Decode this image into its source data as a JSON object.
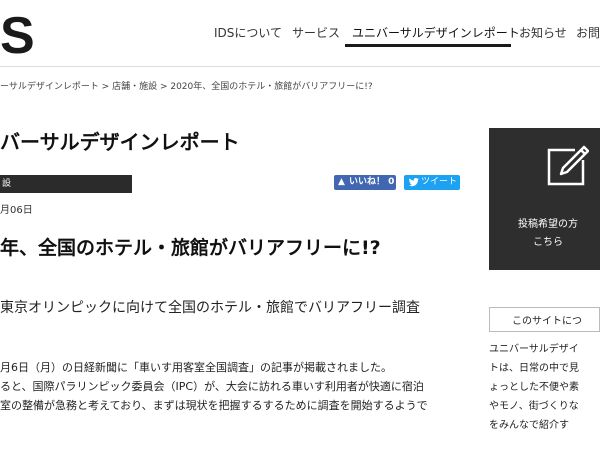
{
  "header": {
    "logo_text": "S",
    "nav": [
      {
        "label": "IDSについて"
      },
      {
        "label": "サービス"
      },
      {
        "label": "ユニバーサルデザインレポート",
        "active": true
      },
      {
        "label": "お知らせ"
      },
      {
        "label": "お問"
      }
    ]
  },
  "breadcrumb": "ーサルデザインレポート > 店舗・施設 > 2020年、全国のホテル・旅館がバリアフリーに!?",
  "section_title": "バーサルデザインレポート",
  "category_label": "設",
  "social": {
    "like_label": "いいね！ 0",
    "tweet_label": "ツイート"
  },
  "article": {
    "date": "月06日",
    "title": "年、全国のホテル・旅館がバリアフリーに!?",
    "lead": "東京オリンピックに向けて全国のホテル・旅館でバリアフリー調査",
    "body_lines": [
      "月6日（月）の日経新聞に「車いす用客室全国調査」の記事が掲載されました。",
      "ると、国際パラリンピック委員会（IPC）が、大会に訪れる車いす利用者が快適に宿泊",
      "室の整備が急務と考えており、まずは現状を把握するするために調査を開始するようで"
    ]
  },
  "sidebar": {
    "post_lines": [
      "投稿希望の方",
      "こちら"
    ],
    "about_title": "このサイトにつ",
    "about_lines": [
      "ユニバーサルデザイ",
      "トは、日常の中で見",
      "ょっとした不便や素",
      "やモノ、街づくりな",
      "をみんなで紹介す"
    ]
  },
  "colors": {
    "dark_box": "#2e2e2e",
    "facebook_blue": "#4267b2",
    "twitter_blue": "#1da1f2"
  }
}
